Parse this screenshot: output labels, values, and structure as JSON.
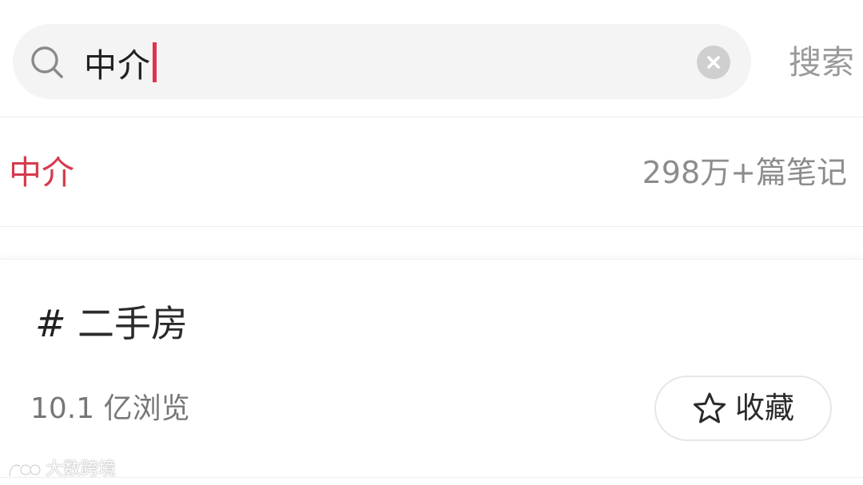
{
  "search": {
    "query": "中介",
    "submit_label": "搜索",
    "icons": {
      "search": "search-icon",
      "clear": "close-circle-icon"
    }
  },
  "suggestion": {
    "keyword": "中介",
    "count_text": "298万+篇笔记",
    "keyword_color": "#d63a4e"
  },
  "topic": {
    "hash": "#",
    "title": "二手房",
    "views": "10.1 亿浏览",
    "collect_label": "收藏",
    "collect_icon": "star-outline-icon"
  },
  "watermark": {
    "text": "大数跨境",
    "logo": "brand-logo"
  },
  "colors": {
    "accent": "#d63a4e",
    "caret": "#e0334e",
    "muted_text": "#8c8c8c",
    "search_box_bg": "#f4f4f4"
  }
}
